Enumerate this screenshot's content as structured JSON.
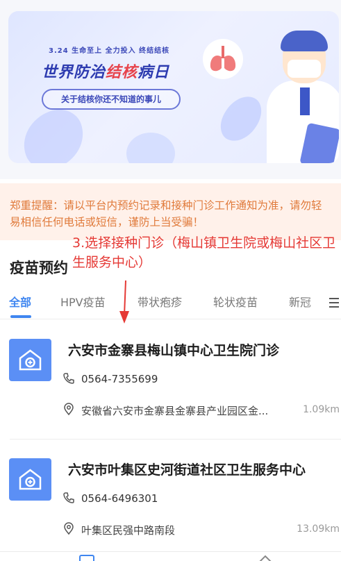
{
  "banner": {
    "date_line": "3.24  生命至上 全力投入 终结结核",
    "title_main": "世界防治",
    "title_highlight": "结核",
    "title_end": "病日",
    "pill_text": "关于结核你还不知道的事儿"
  },
  "notice": {
    "text": "郑重提醒：请以平台内预约记录和接种门诊工作通知为准，请勿轻易相信任何电话或短信，谨防上当受骗！"
  },
  "annotation": {
    "text": "3.选择接种门诊（梅山镇卫生院或梅山社区卫生服务中心）"
  },
  "section": {
    "title": "疫苗预约"
  },
  "tabs": [
    {
      "label": "全部",
      "active": true
    },
    {
      "label": "HPV疫苗",
      "active": false
    },
    {
      "label": "带状疱疹",
      "active": false
    },
    {
      "label": "轮状疫苗",
      "active": false
    },
    {
      "label": "新冠",
      "active": false
    }
  ],
  "clinics": [
    {
      "name": "六安市金寨县梅山镇中心卫生院门诊",
      "phone": "0564-7355699",
      "address": "安徽省六安市金寨县金寨县产业园区金...",
      "distance": "1.09km"
    },
    {
      "name": "六安市叶集区史河街道社区卫生服务中心",
      "phone": "0564-6496301",
      "address": "叶集区民强中路南段",
      "distance": "13.09km"
    }
  ],
  "colors": {
    "accent": "#3f86f0",
    "notice_text": "#e07a3b",
    "annotation": "#e53935",
    "clinic_icon_bg": "#5b8ff5"
  }
}
